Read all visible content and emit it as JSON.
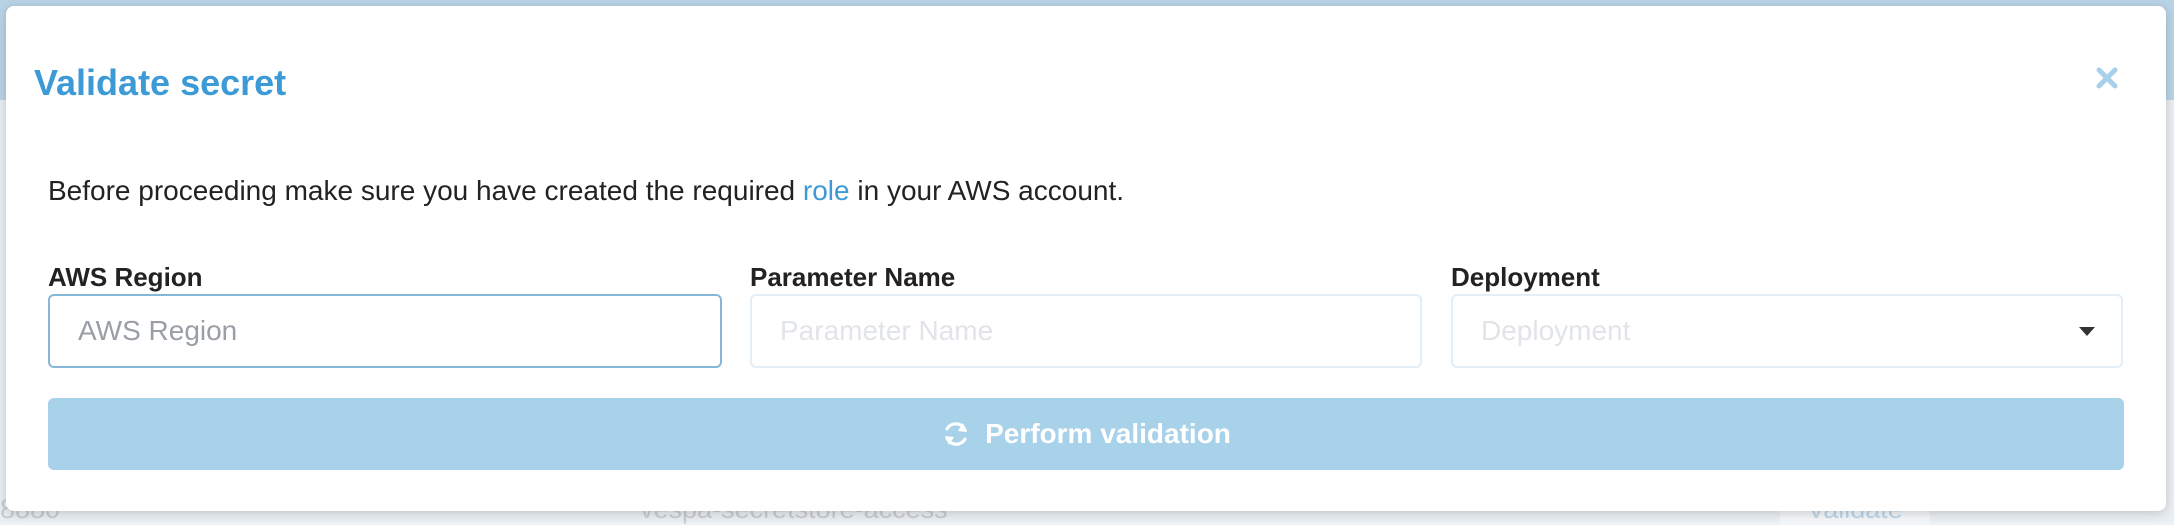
{
  "background": {
    "row_id": "8880",
    "row_name": "vespa-secretstore-access",
    "row_action": "Validate"
  },
  "modal": {
    "title": "Validate secret",
    "close_icon": "close-icon",
    "intro_before": "Before proceeding make sure you have created the required ",
    "intro_link": "role",
    "intro_after": " in your AWS account.",
    "fields": {
      "region": {
        "label": "AWS Region",
        "placeholder": "AWS Region",
        "value": ""
      },
      "parameter": {
        "label": "Parameter Name",
        "placeholder": "Parameter Name",
        "value": ""
      },
      "deployment": {
        "label": "Deployment",
        "selected": "Deployment",
        "icon": "chevron-down-icon"
      }
    },
    "submit": {
      "label": "Perform validation",
      "icon": "refresh-icon"
    }
  },
  "colors": {
    "accent": "#3c9ad6",
    "button_disabled": "#a8d1ea",
    "text": "#222222"
  }
}
